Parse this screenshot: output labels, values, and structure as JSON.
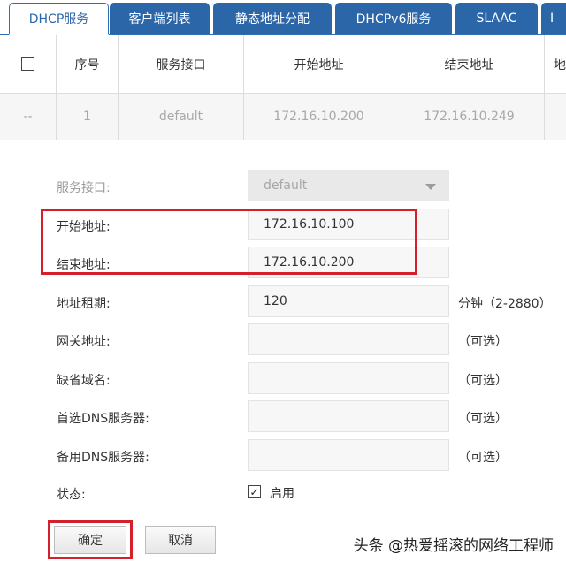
{
  "tabs": [
    {
      "label": "DHCP服务",
      "active": true
    },
    {
      "label": "客户端列表",
      "active": false
    },
    {
      "label": "静态地址分配",
      "active": false
    },
    {
      "label": "DHCPv6服务",
      "active": false
    },
    {
      "label": "SLAAC",
      "active": false
    },
    {
      "label": "I",
      "active": false
    }
  ],
  "table": {
    "headers": [
      "序号",
      "服务接口",
      "开始地址",
      "结束地址",
      "地"
    ],
    "rows": [
      {
        "check": "--",
        "index": "1",
        "interface": "default",
        "start": "172.16.10.200",
        "end": "172.16.10.249"
      }
    ]
  },
  "form": {
    "interface_label": "服务接口:",
    "interface_value": "default",
    "start_label": "开始地址:",
    "start_value": "172.16.10.100",
    "end_label": "结束地址:",
    "end_value": "172.16.10.200",
    "lease_label": "地址租期:",
    "lease_value": "120",
    "lease_hint": "分钟（2-2880）",
    "gateway_label": "网关地址:",
    "gateway_hint": "（可选）",
    "domain_label": "缺省域名:",
    "domain_hint": "（可选）",
    "dns1_label": "首选DNS服务器:",
    "dns1_hint": "（可选）",
    "dns2_label": "备用DNS服务器:",
    "dns2_hint": "（可选）",
    "status_label": "状态:",
    "status_checkbox_mark": "✓",
    "status_value": "启用"
  },
  "buttons": {
    "confirm": "确定",
    "cancel": "取消"
  },
  "watermark": "头条 @热爱摇滚的网络工程师",
  "colors": {
    "tab_blue": "#2b66a9",
    "highlight_red": "#d3202a"
  }
}
